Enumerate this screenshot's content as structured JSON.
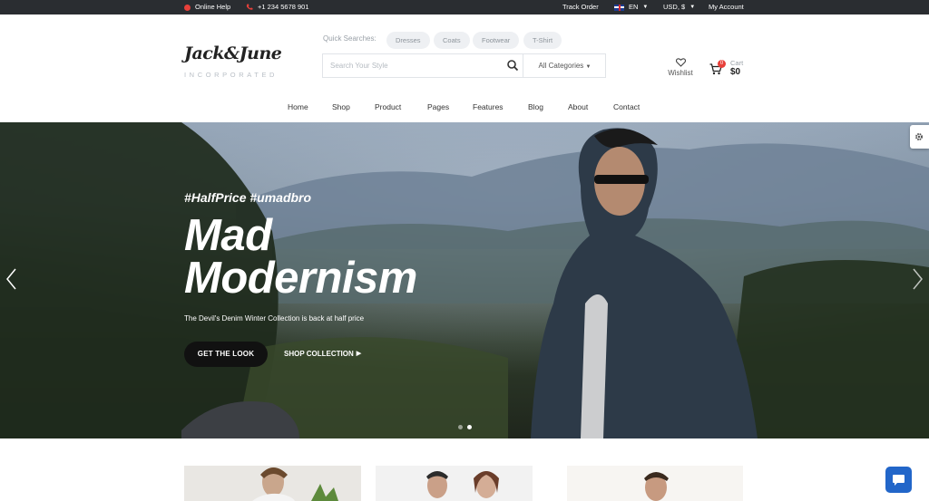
{
  "topbar": {
    "help": "Online Help",
    "phone": "+1 234 5678 901",
    "track_order": "Track Order",
    "language": "EN",
    "currency": "USD, $",
    "account": "My Account"
  },
  "logo": {
    "name": "Jack&June",
    "tagline": "INCORPORATED"
  },
  "quick_searches": {
    "label": "Quick Searches:",
    "chips": [
      "Dresses",
      "Coats",
      "Footwear",
      "T-Shirt"
    ]
  },
  "search": {
    "placeholder": "Search Your Style",
    "category": "All Categories"
  },
  "wishlist": {
    "label": "Wishlist"
  },
  "cart": {
    "label": "Cart",
    "count": "0",
    "total": "$0"
  },
  "nav": [
    "Home",
    "Shop",
    "Product",
    "Pages",
    "Features",
    "Blog",
    "About",
    "Contact"
  ],
  "hero": {
    "tag": "#HalfPrice #umadbro",
    "title_line1": "Mad",
    "title_line2": "Modernism",
    "subtitle": "The Devil's Denim Winter Collection is back at half price",
    "cta_primary": "GET THE LOOK",
    "cta_secondary": "SHOP COLLECTION",
    "slide_count": 2,
    "active_slide": 2
  },
  "icons": {
    "help": "help-dot-icon",
    "phone": "phone-icon",
    "flag": "uk-flag-icon",
    "search": "search-icon",
    "wishlist": "heart-icon",
    "cart": "cart-icon",
    "settings": "gear-icon",
    "chat": "chat-icon"
  },
  "colors": {
    "accent": "#e8403a",
    "topbar": "#2a2d31",
    "chat": "#2266c9"
  }
}
